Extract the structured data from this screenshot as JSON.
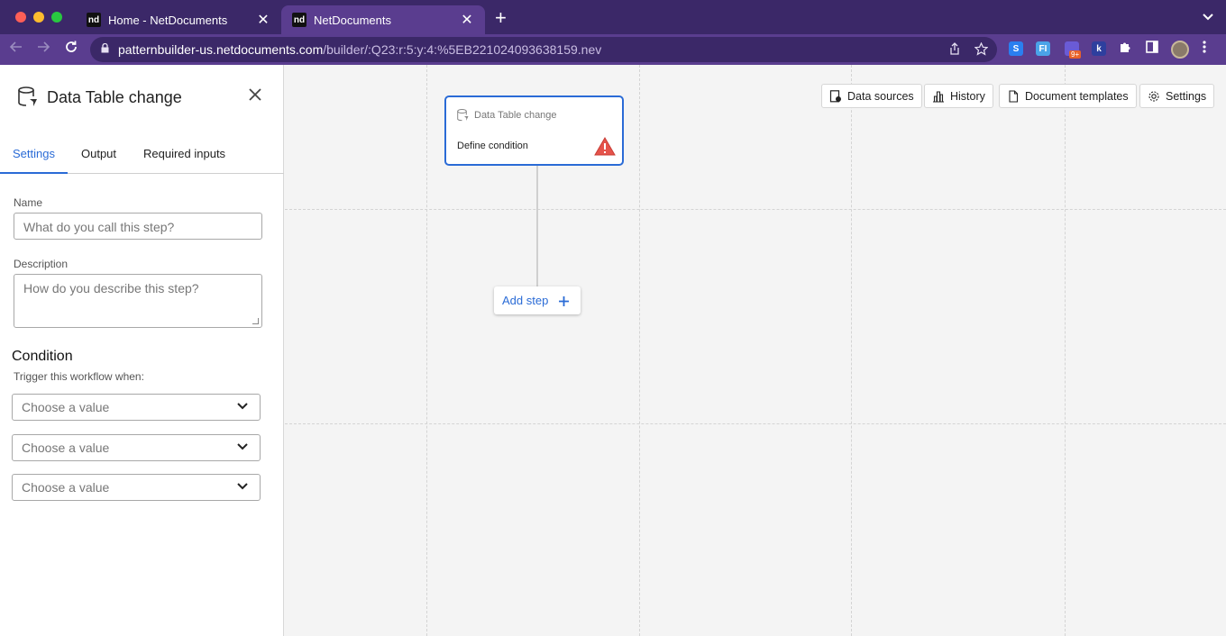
{
  "browser": {
    "tabs": [
      {
        "favicon": "nd",
        "title": "Home - NetDocuments",
        "close": "✕"
      },
      {
        "favicon": "nd",
        "title": "NetDocuments",
        "close": "✕"
      }
    ],
    "new_tab": "+",
    "url_host": "patternbuilder-us.netdocuments.com",
    "url_path": "/builder/:Q23:r:5:y:4:%5EB221024093638159.nev",
    "extension_badge": "9+",
    "extensions": [
      "S",
      "FI",
      "k"
    ]
  },
  "panel": {
    "title": "Data Table change",
    "tabs": [
      {
        "label": "Settings",
        "active": true
      },
      {
        "label": "Output",
        "active": false
      },
      {
        "label": "Required inputs",
        "active": false
      }
    ],
    "name_label": "Name",
    "name_placeholder": "What do you call this step?",
    "description_label": "Description",
    "description_placeholder": "How do you describe this step?",
    "condition_title": "Condition",
    "condition_subtitle": "Trigger this workflow when:",
    "selects": [
      {
        "value": "Choose a value"
      },
      {
        "value": "Choose a value"
      },
      {
        "value": "Choose a value"
      }
    ]
  },
  "canvas": {
    "buttons": [
      {
        "label": "Data sources",
        "icon": "data-sources-icon"
      },
      {
        "label": "History",
        "icon": "history-icon"
      },
      {
        "label": "Document templates",
        "icon": "document-icon"
      },
      {
        "label": "Settings",
        "icon": "gear-icon"
      }
    ],
    "node": {
      "title": "Data Table change",
      "body": "Define condition",
      "status_color": "#e5534b"
    },
    "add_step_label": "Add step"
  },
  "colors": {
    "accent": "#2a6bd6",
    "browser_frame": "#3b2868",
    "browser_toolbar": "#5a3d8f",
    "warning": "#e5534b"
  }
}
